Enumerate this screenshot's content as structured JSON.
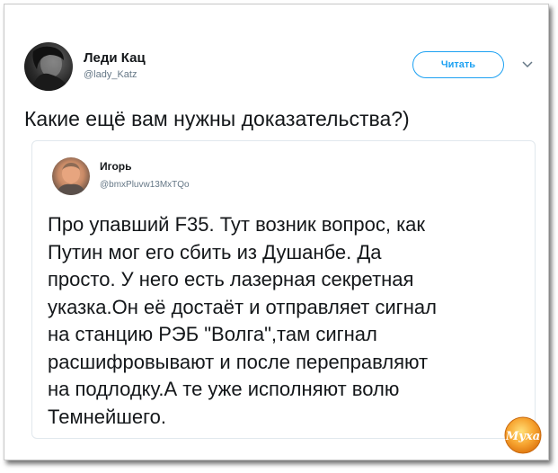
{
  "tweet": {
    "author": {
      "name": "Леди Кац",
      "handle": "@lady_Katz"
    },
    "follow_label": "Читать",
    "text": "Какие ещё вам нужны доказательства?)",
    "quoted": {
      "author": {
        "name": "Игорь",
        "handle": "@bmxPluvw13MxTQo"
      },
      "lines": [
        "Про упавший F35. Тут возник вопрос, как",
        "Путин мог его сбить из Душанбе. Да",
        "просто. У него есть лазерная секретная",
        "указка.Он её  достаёт и отправляет сигнал",
        "на станцию РЭБ \"Волга\",там сигнал",
        "расшифровывают и после переправляют",
        "на подлодку.А те уже исполняют волю",
        "Темнейшего."
      ]
    }
  },
  "watermark": {
    "text": "Муха"
  },
  "colors": {
    "accent": "#1da1f2",
    "text": "#14171a",
    "muted": "#657786",
    "border": "#e1e8ed"
  },
  "icons": {
    "menu": "chevron-down-icon"
  }
}
